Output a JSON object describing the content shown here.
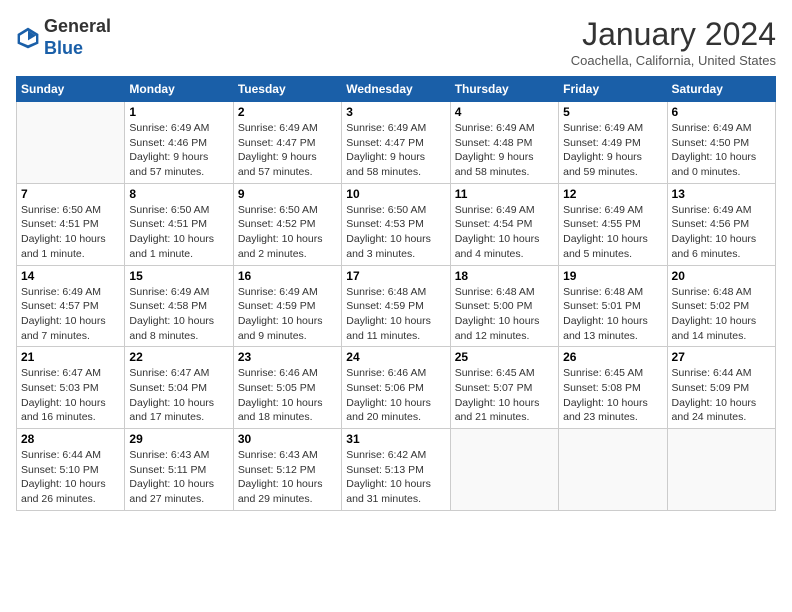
{
  "header": {
    "logo_general": "General",
    "logo_blue": "Blue",
    "month_title": "January 2024",
    "subtitle": "Coachella, California, United States"
  },
  "days_of_week": [
    "Sunday",
    "Monday",
    "Tuesday",
    "Wednesday",
    "Thursday",
    "Friday",
    "Saturday"
  ],
  "weeks": [
    [
      {
        "day": "",
        "info": ""
      },
      {
        "day": "1",
        "info": "Sunrise: 6:49 AM\nSunset: 4:46 PM\nDaylight: 9 hours\nand 57 minutes."
      },
      {
        "day": "2",
        "info": "Sunrise: 6:49 AM\nSunset: 4:47 PM\nDaylight: 9 hours\nand 57 minutes."
      },
      {
        "day": "3",
        "info": "Sunrise: 6:49 AM\nSunset: 4:47 PM\nDaylight: 9 hours\nand 58 minutes."
      },
      {
        "day": "4",
        "info": "Sunrise: 6:49 AM\nSunset: 4:48 PM\nDaylight: 9 hours\nand 58 minutes."
      },
      {
        "day": "5",
        "info": "Sunrise: 6:49 AM\nSunset: 4:49 PM\nDaylight: 9 hours\nand 59 minutes."
      },
      {
        "day": "6",
        "info": "Sunrise: 6:49 AM\nSunset: 4:50 PM\nDaylight: 10 hours\nand 0 minutes."
      }
    ],
    [
      {
        "day": "7",
        "info": "Sunrise: 6:50 AM\nSunset: 4:51 PM\nDaylight: 10 hours\nand 1 minute."
      },
      {
        "day": "8",
        "info": "Sunrise: 6:50 AM\nSunset: 4:51 PM\nDaylight: 10 hours\nand 1 minute."
      },
      {
        "day": "9",
        "info": "Sunrise: 6:50 AM\nSunset: 4:52 PM\nDaylight: 10 hours\nand 2 minutes."
      },
      {
        "day": "10",
        "info": "Sunrise: 6:50 AM\nSunset: 4:53 PM\nDaylight: 10 hours\nand 3 minutes."
      },
      {
        "day": "11",
        "info": "Sunrise: 6:49 AM\nSunset: 4:54 PM\nDaylight: 10 hours\nand 4 minutes."
      },
      {
        "day": "12",
        "info": "Sunrise: 6:49 AM\nSunset: 4:55 PM\nDaylight: 10 hours\nand 5 minutes."
      },
      {
        "day": "13",
        "info": "Sunrise: 6:49 AM\nSunset: 4:56 PM\nDaylight: 10 hours\nand 6 minutes."
      }
    ],
    [
      {
        "day": "14",
        "info": "Sunrise: 6:49 AM\nSunset: 4:57 PM\nDaylight: 10 hours\nand 7 minutes."
      },
      {
        "day": "15",
        "info": "Sunrise: 6:49 AM\nSunset: 4:58 PM\nDaylight: 10 hours\nand 8 minutes."
      },
      {
        "day": "16",
        "info": "Sunrise: 6:49 AM\nSunset: 4:59 PM\nDaylight: 10 hours\nand 9 minutes."
      },
      {
        "day": "17",
        "info": "Sunrise: 6:48 AM\nSunset: 4:59 PM\nDaylight: 10 hours\nand 11 minutes."
      },
      {
        "day": "18",
        "info": "Sunrise: 6:48 AM\nSunset: 5:00 PM\nDaylight: 10 hours\nand 12 minutes."
      },
      {
        "day": "19",
        "info": "Sunrise: 6:48 AM\nSunset: 5:01 PM\nDaylight: 10 hours\nand 13 minutes."
      },
      {
        "day": "20",
        "info": "Sunrise: 6:48 AM\nSunset: 5:02 PM\nDaylight: 10 hours\nand 14 minutes."
      }
    ],
    [
      {
        "day": "21",
        "info": "Sunrise: 6:47 AM\nSunset: 5:03 PM\nDaylight: 10 hours\nand 16 minutes."
      },
      {
        "day": "22",
        "info": "Sunrise: 6:47 AM\nSunset: 5:04 PM\nDaylight: 10 hours\nand 17 minutes."
      },
      {
        "day": "23",
        "info": "Sunrise: 6:46 AM\nSunset: 5:05 PM\nDaylight: 10 hours\nand 18 minutes."
      },
      {
        "day": "24",
        "info": "Sunrise: 6:46 AM\nSunset: 5:06 PM\nDaylight: 10 hours\nand 20 minutes."
      },
      {
        "day": "25",
        "info": "Sunrise: 6:45 AM\nSunset: 5:07 PM\nDaylight: 10 hours\nand 21 minutes."
      },
      {
        "day": "26",
        "info": "Sunrise: 6:45 AM\nSunset: 5:08 PM\nDaylight: 10 hours\nand 23 minutes."
      },
      {
        "day": "27",
        "info": "Sunrise: 6:44 AM\nSunset: 5:09 PM\nDaylight: 10 hours\nand 24 minutes."
      }
    ],
    [
      {
        "day": "28",
        "info": "Sunrise: 6:44 AM\nSunset: 5:10 PM\nDaylight: 10 hours\nand 26 minutes."
      },
      {
        "day": "29",
        "info": "Sunrise: 6:43 AM\nSunset: 5:11 PM\nDaylight: 10 hours\nand 27 minutes."
      },
      {
        "day": "30",
        "info": "Sunrise: 6:43 AM\nSunset: 5:12 PM\nDaylight: 10 hours\nand 29 minutes."
      },
      {
        "day": "31",
        "info": "Sunrise: 6:42 AM\nSunset: 5:13 PM\nDaylight: 10 hours\nand 31 minutes."
      },
      {
        "day": "",
        "info": ""
      },
      {
        "day": "",
        "info": ""
      },
      {
        "day": "",
        "info": ""
      }
    ]
  ]
}
